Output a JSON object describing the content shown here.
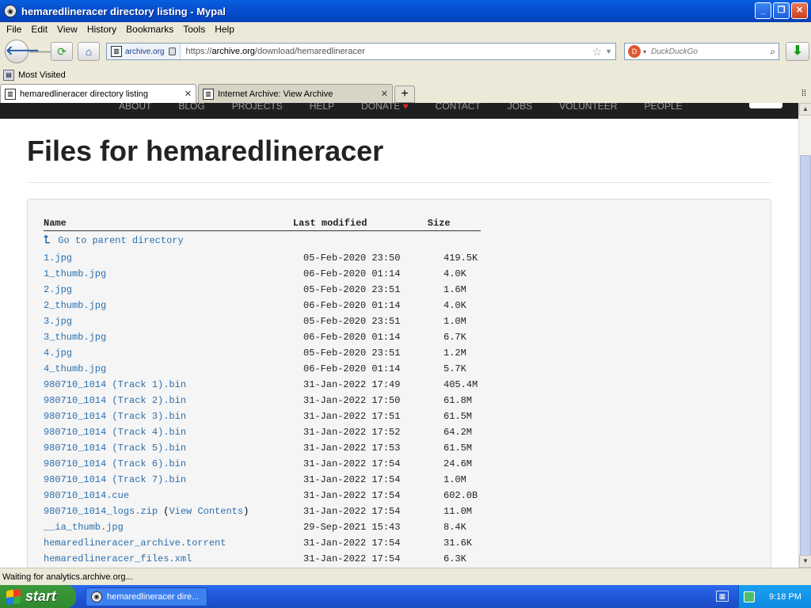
{
  "window": {
    "title": "hemaredlineracer directory listing - Mypal"
  },
  "menu": [
    "File",
    "Edit",
    "View",
    "History",
    "Bookmarks",
    "Tools",
    "Help"
  ],
  "nav": {
    "site_label": "archive.org",
    "url_prefix": "https://",
    "url_host": "archive.org",
    "url_path": "/download/hemaredlineracer",
    "search_engine": "DuckDuckGo"
  },
  "bookmarks": {
    "most_visited": "Most Visited"
  },
  "tabs": [
    {
      "label": "hemaredlineracer directory listing",
      "active": true
    },
    {
      "label": "Internet Archive: View Archive",
      "active": false
    }
  ],
  "ia_nav": [
    "ABOUT",
    "BLOG",
    "PROJECTS",
    "HELP",
    "DONATE",
    "CONTACT",
    "JOBS",
    "VOLUNTEER",
    "PEOPLE"
  ],
  "page": {
    "title": "Files for hemaredlineracer",
    "headers": {
      "name": "Name",
      "modified": "Last modified",
      "size": "Size"
    },
    "parent_label": "Go to parent directory",
    "files": [
      {
        "name": "1.jpg",
        "modified": "05-Feb-2020 23:50",
        "size": "419.5K"
      },
      {
        "name": "1_thumb.jpg",
        "modified": "06-Feb-2020 01:14",
        "size": "4.0K"
      },
      {
        "name": "2.jpg",
        "modified": "05-Feb-2020 23:51",
        "size": "1.6M"
      },
      {
        "name": "2_thumb.jpg",
        "modified": "06-Feb-2020 01:14",
        "size": "4.0K"
      },
      {
        "name": "3.jpg",
        "modified": "05-Feb-2020 23:51",
        "size": "1.0M"
      },
      {
        "name": "3_thumb.jpg",
        "modified": "06-Feb-2020 01:14",
        "size": "6.7K"
      },
      {
        "name": "4.jpg",
        "modified": "05-Feb-2020 23:51",
        "size": "1.2M"
      },
      {
        "name": "4_thumb.jpg",
        "modified": "06-Feb-2020 01:14",
        "size": "5.7K"
      },
      {
        "name": "980710_1014 (Track 1).bin",
        "modified": "31-Jan-2022 17:49",
        "size": "405.4M"
      },
      {
        "name": "980710_1014 (Track 2).bin",
        "modified": "31-Jan-2022 17:50",
        "size": "61.8M"
      },
      {
        "name": "980710_1014 (Track 3).bin",
        "modified": "31-Jan-2022 17:51",
        "size": "61.5M"
      },
      {
        "name": "980710_1014 (Track 4).bin",
        "modified": "31-Jan-2022 17:52",
        "size": "64.2M"
      },
      {
        "name": "980710_1014 (Track 5).bin",
        "modified": "31-Jan-2022 17:53",
        "size": "61.5M"
      },
      {
        "name": "980710_1014 (Track 6).bin",
        "modified": "31-Jan-2022 17:54",
        "size": "24.6M"
      },
      {
        "name": "980710_1014 (Track 7).bin",
        "modified": "31-Jan-2022 17:54",
        "size": "1.0M"
      },
      {
        "name": "980710_1014.cue",
        "modified": "31-Jan-2022 17:54",
        "size": "602.0B"
      },
      {
        "name": "980710_1014_logs.zip",
        "extra": "View Contents",
        "modified": "31-Jan-2022 17:54",
        "size": "11.0M"
      },
      {
        "name": "__ia_thumb.jpg",
        "modified": "29-Sep-2021 15:43",
        "size": "8.4K"
      },
      {
        "name": "hemaredlineracer_archive.torrent",
        "modified": "31-Jan-2022 17:54",
        "size": "31.6K"
      },
      {
        "name": "hemaredlineracer_files.xml",
        "modified": "31-Jan-2022 17:54",
        "size": "6.3K"
      }
    ]
  },
  "status": {
    "text": "Waiting for analytics.archive.org..."
  },
  "taskbar": {
    "start": "start",
    "item": "hemaredlineracer dire...",
    "clock": "9:18 PM"
  },
  "colors": {
    "link": "#2a6fad",
    "title_bar": "#0550d0",
    "ia_nav_bg": "#1f1f1f"
  }
}
